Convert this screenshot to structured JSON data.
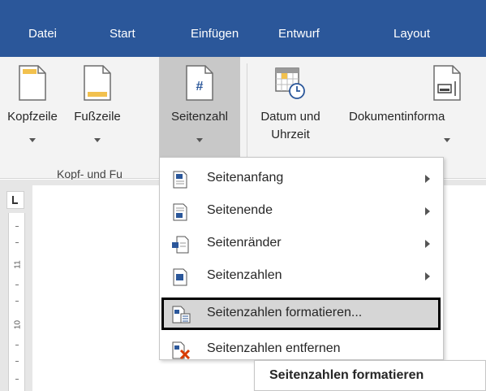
{
  "tabs": [
    {
      "label": "Datei"
    },
    {
      "label": "Start"
    },
    {
      "label": "Einfügen"
    },
    {
      "label": "Entwurf"
    },
    {
      "label": "Layout"
    }
  ],
  "ribbon": {
    "header_label": "Kopfzeile",
    "footer_label": "Fußzeile",
    "page_number_label": "Seitenzahl",
    "date_time_label_line1": "Datum und",
    "date_time_label_line2": "Uhrzeit",
    "doc_info_label": "Dokumentinforma",
    "group_label": "Kopf- und Fu"
  },
  "menu": {
    "items": [
      {
        "label": "Seitenanfang",
        "icon": "page-top-icon",
        "submenu": true
      },
      {
        "label": "Seitenende",
        "icon": "page-bottom-icon",
        "submenu": true
      },
      {
        "label": "Seitenränder",
        "icon": "page-margins-icon",
        "submenu": true
      },
      {
        "label": "Seitenzahlen",
        "icon": "current-position-icon",
        "submenu": true
      },
      {
        "label": "Seitenzahlen formatieren...",
        "icon": "format-page-numbers-icon",
        "submenu": false,
        "highlighted": true
      },
      {
        "label": "Seitenzahlen entfernen",
        "icon": "remove-page-numbers-icon",
        "submenu": false
      }
    ]
  },
  "tooltip": {
    "text": "Seitenzahlen formatieren"
  },
  "ruler": {
    "labels": [
      "11",
      "10"
    ]
  },
  "colors": {
    "tabbar": "#2b579a",
    "ribbon": "#f3f3f3",
    "active_button": "#c8c8c8",
    "highlight": "#d6d6d6",
    "remove_icon": "#d83b01"
  }
}
